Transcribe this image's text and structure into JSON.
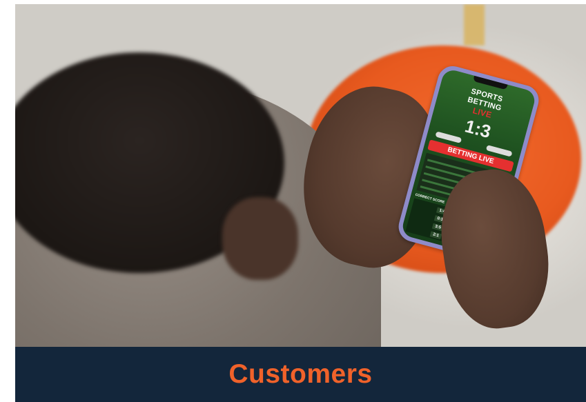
{
  "phone_screen": {
    "line1": "SPORTS",
    "line2": "BETTING",
    "line3": "LIVE",
    "score": "1:3",
    "banner": "BETTING LIVE",
    "sub_heading": "CORRECT SCORE",
    "cells": [
      "1:4",
      "0:1",
      "3:5",
      "2:1"
    ]
  },
  "footer": {
    "title": "Customers"
  },
  "colors": {
    "accent": "#f0622a",
    "footer_bg": "#13263b",
    "ottoman": "#e85a1f"
  }
}
